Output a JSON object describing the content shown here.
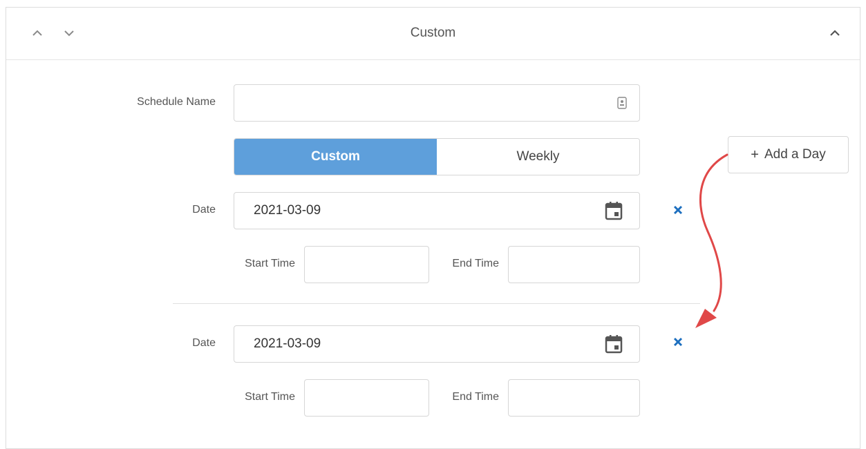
{
  "header": {
    "title": "Custom",
    "move_up_icon": "chevron-up-icon",
    "move_down_icon": "chevron-down-icon",
    "collapse_icon": "chevron-up-icon"
  },
  "schedule": {
    "name_label": "Schedule Name",
    "name_value": "",
    "name_field_icon": "contact-card-icon"
  },
  "mode_toggle": {
    "options": [
      "Custom",
      "Weekly"
    ],
    "selected": "Custom",
    "active_color": "#5e9fdb"
  },
  "add_day_button": {
    "label": "Add a Day",
    "icon": "plus-icon"
  },
  "days": [
    {
      "date_label": "Date",
      "date_value": "2021-03-09",
      "start_time_label": "Start Time",
      "start_time_value": "",
      "end_time_label": "End Time",
      "end_time_value": "",
      "calendar_icon": "calendar-icon",
      "remove_icon": "close-icon"
    },
    {
      "date_label": "Date",
      "date_value": "2021-03-09",
      "start_time_label": "Start Time",
      "start_time_value": "",
      "end_time_label": "End Time",
      "end_time_value": "",
      "calendar_icon": "calendar-icon",
      "remove_icon": "close-icon"
    }
  ],
  "colors": {
    "remove_icon": "#1d6fbf",
    "annotation_arrow": "#e04848",
    "border": "#d6d6d6"
  }
}
